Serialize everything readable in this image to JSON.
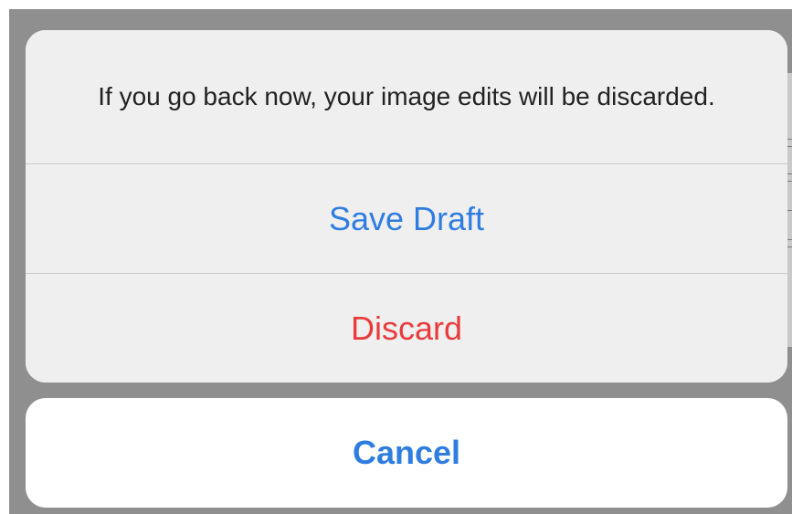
{
  "dialog": {
    "message": "If you go back now, your image edits will be discarded.",
    "actions": {
      "save_draft": "Save Draft",
      "discard": "Discard"
    },
    "cancel": "Cancel"
  },
  "colors": {
    "accent": "#2f7de1",
    "destructive": "#ea3b3c",
    "sheet_background": "#efefef",
    "backdrop": "#8f8f8f"
  }
}
